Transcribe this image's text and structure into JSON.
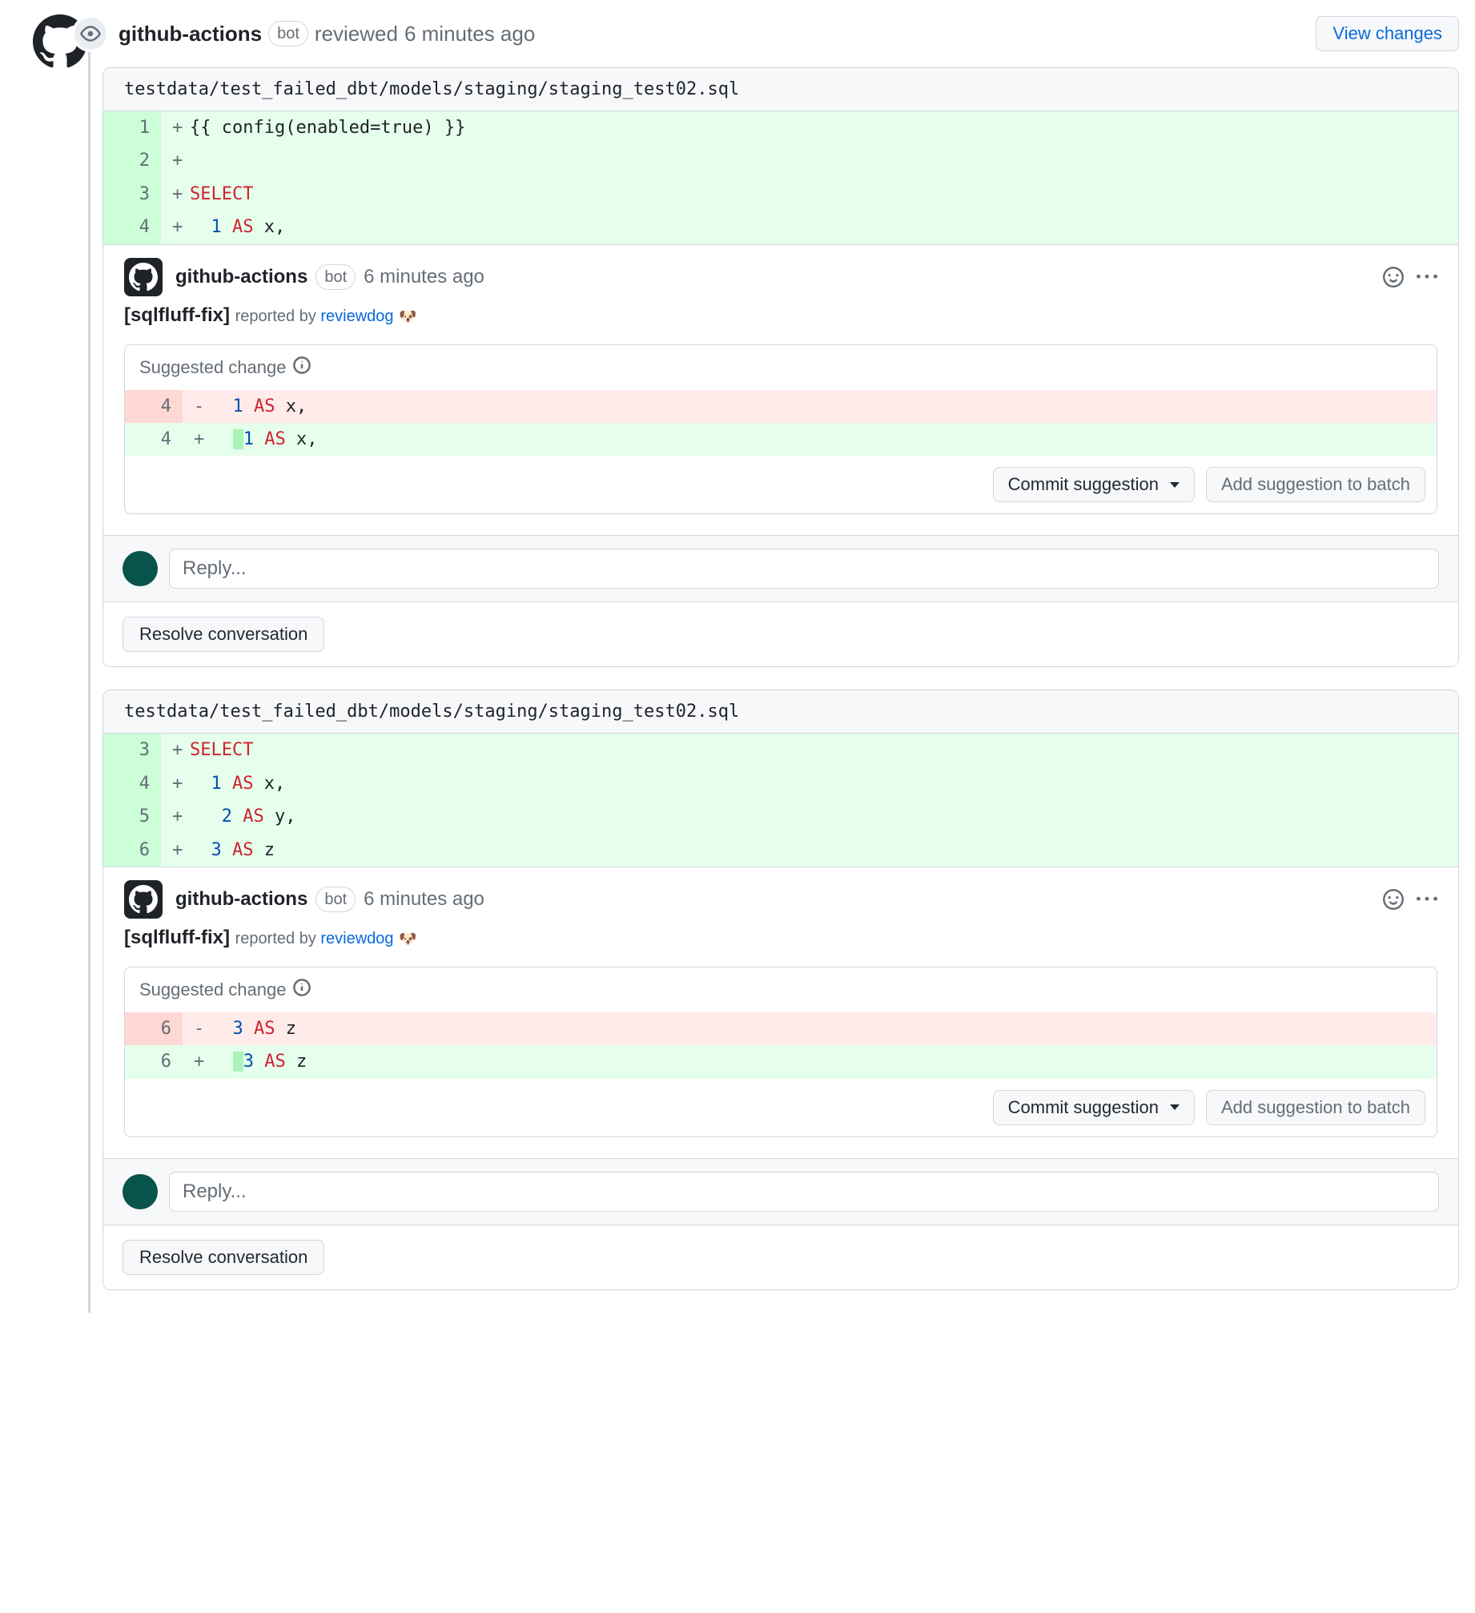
{
  "header": {
    "actor": "github-actions",
    "bot_label": "bot",
    "action_text": "reviewed",
    "time": "6 minutes ago",
    "view_changes": "View changes"
  },
  "buttons": {
    "commit_suggestion": "Commit suggestion",
    "add_to_batch": "Add suggestion to batch",
    "reply_placeholder": "Reply...",
    "resolve": "Resolve conversation"
  },
  "suggestion_label": "Suggested change",
  "comment_meta": {
    "actor": "github-actions",
    "bot_label": "bot",
    "time": "6 minutes ago",
    "title": "[sqlfluff-fix]",
    "reported_by_prefix": "reported by ",
    "reported_by_link": "reviewdog",
    "dog": "🐶"
  },
  "blocks": [
    {
      "file": "testdata/test_failed_dbt/models/staging/staging_test02.sql",
      "context": [
        {
          "num": "1",
          "html": "{{ config(enabled=true) }}"
        },
        {
          "num": "2",
          "html": ""
        },
        {
          "num": "3",
          "html": "<span class='kw-red'>SELECT</span>"
        },
        {
          "num": "4",
          "html": "  <span class='kw-blue'>1</span> <span class='kw-red'>AS</span> x,"
        }
      ],
      "suggestion": {
        "del": {
          "num": "4",
          "html": "  <span class='kw-blue'>1</span> <span class='kw-red'>AS</span> x,"
        },
        "add": {
          "num": "4",
          "html": "  <span class='kw-green-bg'> </span><span class='kw-blue'>1</span> <span class='kw-red'>AS</span> x,"
        }
      }
    },
    {
      "file": "testdata/test_failed_dbt/models/staging/staging_test02.sql",
      "context": [
        {
          "num": "3",
          "html": "<span class='kw-red'>SELECT</span>"
        },
        {
          "num": "4",
          "html": "  <span class='kw-blue'>1</span> <span class='kw-red'>AS</span> x,"
        },
        {
          "num": "5",
          "html": "   <span class='kw-blue'>2</span> <span class='kw-red'>AS</span> y,"
        },
        {
          "num": "6",
          "html": "  <span class='kw-blue'>3</span> <span class='kw-red'>AS</span> z"
        }
      ],
      "suggestion": {
        "del": {
          "num": "6",
          "html": "  <span class='kw-blue'>3</span> <span class='kw-red'>AS</span> z"
        },
        "add": {
          "num": "6",
          "html": "  <span class='kw-green-bg'> </span><span class='kw-blue'>3</span> <span class='kw-red'>AS</span> z"
        }
      }
    }
  ]
}
